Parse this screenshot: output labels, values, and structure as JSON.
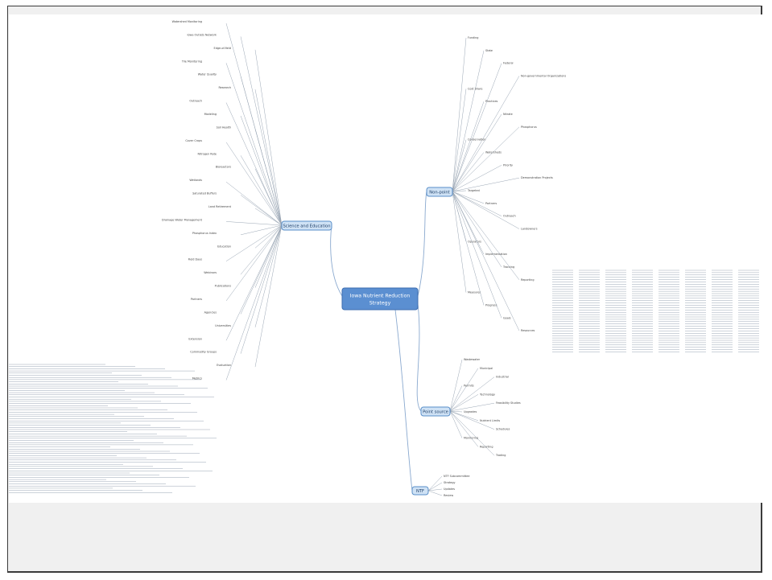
{
  "center": {
    "line1": "Iowa Nutrient Reduction",
    "line2": "Strategy"
  },
  "branches": {
    "science": "Science and Education",
    "nonpoint": "Non-point",
    "point": "Point source",
    "ntf": "NTF"
  },
  "science_items": [
    "Watershed Monitoring",
    "Iowa Outlets Network",
    "Edge-of-field",
    "Tile Monitoring",
    "Water Quality",
    "Research",
    "Outreach",
    "Modeling",
    "Soil Health",
    "Cover Crops",
    "Nitrogen Rate",
    "Bioreactors",
    "Wetlands",
    "Saturated Buffers",
    "Land Retirement",
    "Drainage Water Management",
    "Phosphorus Index",
    "Education",
    "Field Days",
    "Webinars",
    "Publications",
    "Partners",
    "Agencies",
    "Universities",
    "Extension",
    "Commodity Groups",
    "Evaluation",
    "Metrics"
  ],
  "nonpoint_items": [
    "Funding",
    "State",
    "Federal",
    "Non-governmental Organizations",
    "Cost Share",
    "Practices",
    "Nitrate",
    "Phosphorus",
    "Conservation",
    "Watersheds",
    "Priority",
    "Demonstration Projects",
    "Targeted",
    "Partners",
    "Outreach",
    "Landowners",
    "Operators",
    "Implementation",
    "Tracking",
    "Reporting",
    "Measures",
    "Progress",
    "Goals",
    "Resources"
  ],
  "point_items": [
    "Wastewater",
    "Municipal",
    "Industrial",
    "Permits",
    "Technology",
    "Feasibility Studies",
    "Upgrades",
    "Nutrient Limits",
    "Schedules",
    "Monitoring",
    "Reporting",
    "Trading"
  ],
  "ntf_items": [
    "NTF Subcommittee",
    "Strategy",
    "Updates",
    "Review"
  ],
  "colors": {
    "center": "#5b8fd1",
    "branch_fill": "#cfe2f5",
    "edge": "#8aa9cf",
    "frame": "#f0f0f0"
  }
}
